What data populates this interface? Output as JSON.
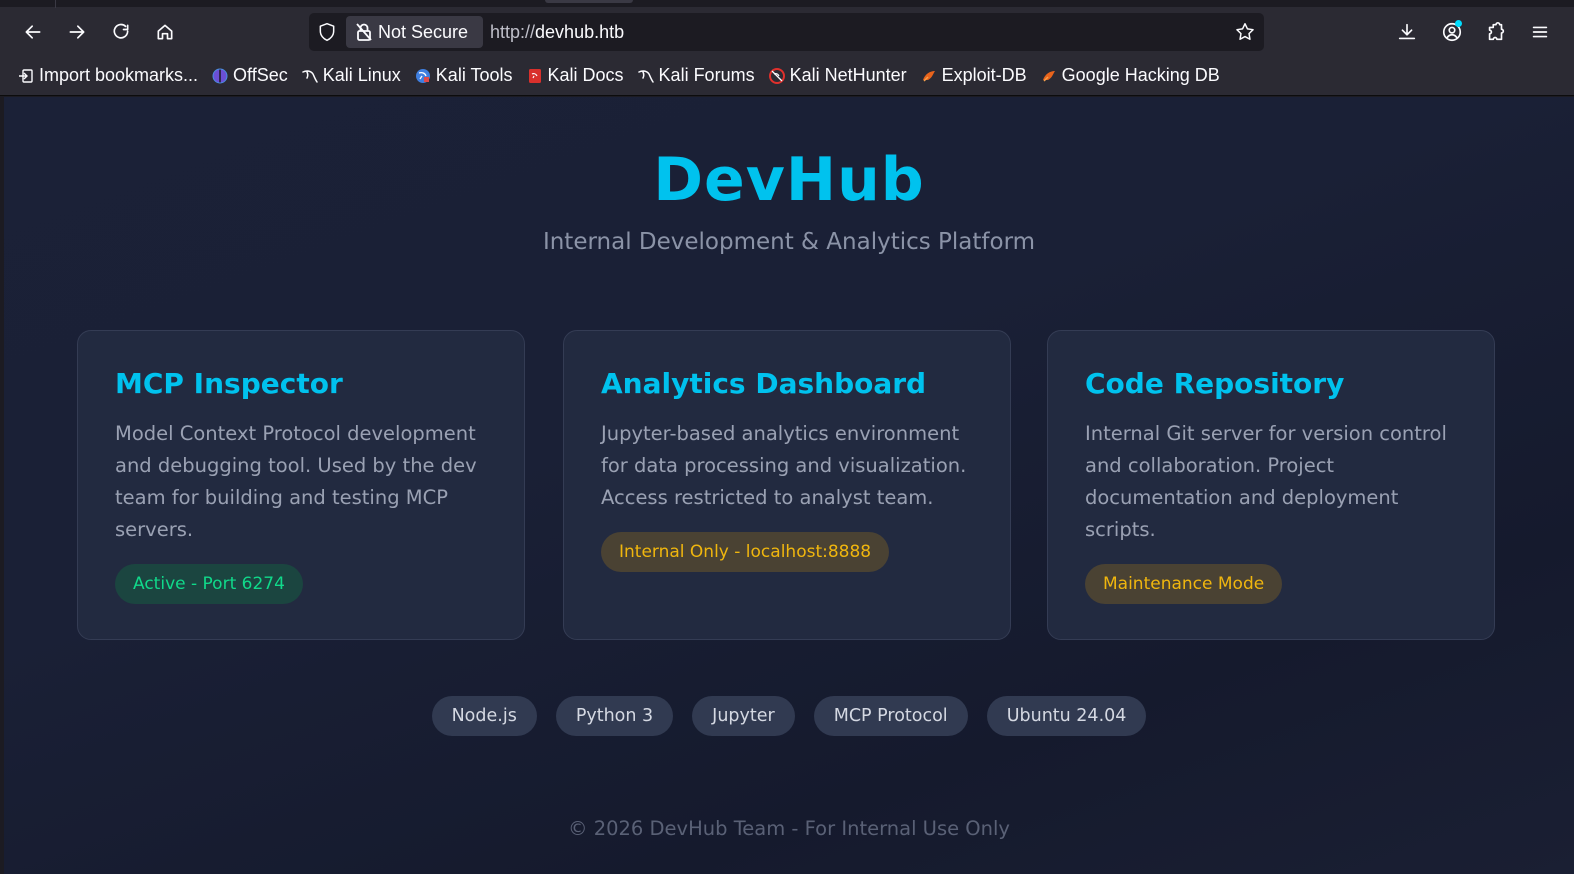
{
  "browser": {
    "url_security_label": "Not Secure",
    "url_scheme": "http://",
    "url_host": "devhub.htb",
    "bookmarks": [
      {
        "label": "Import bookmarks...",
        "icon": "import-icon"
      },
      {
        "label": "OffSec",
        "icon": "offsec-icon"
      },
      {
        "label": "Kali Linux",
        "icon": "kali-dragon-icon"
      },
      {
        "label": "Kali Tools",
        "icon": "kali-tools-icon"
      },
      {
        "label": "Kali Docs",
        "icon": "kali-docs-icon"
      },
      {
        "label": "Kali Forums",
        "icon": "kali-dragon-icon"
      },
      {
        "label": "Kali NetHunter",
        "icon": "nethunter-icon"
      },
      {
        "label": "Exploit-DB",
        "icon": "exploitdb-icon"
      },
      {
        "label": "Google Hacking DB",
        "icon": "exploitdb-icon"
      }
    ]
  },
  "hero": {
    "title": "DevHub",
    "subtitle": "Internal Development & Analytics Platform"
  },
  "cards": [
    {
      "title": "MCP Inspector",
      "description": "Model Context Protocol development and debugging tool. Used by the dev team for building and testing MCP servers.",
      "status": "Active - Port 6274",
      "status_kind": "ok"
    },
    {
      "title": "Analytics Dashboard",
      "description": "Jupyter-based analytics environment for data processing and visualization. Access restricted to analyst team.",
      "status": "Internal Only - localhost:8888",
      "status_kind": "warn"
    },
    {
      "title": "Code Repository",
      "description": "Internal Git server for version control and collaboration. Project documentation and deployment scripts.",
      "status": "Maintenance Mode",
      "status_kind": "warn"
    }
  ],
  "tech_tags": [
    "Node.js",
    "Python 3",
    "Jupyter",
    "MCP Protocol",
    "Ubuntu 24.04"
  ],
  "footer": "© 2026 DevHub Team - For Internal Use Only",
  "colors": {
    "accent": "#00c2ee",
    "status_ok": "#10d98a",
    "status_warn": "#f0b60e"
  }
}
